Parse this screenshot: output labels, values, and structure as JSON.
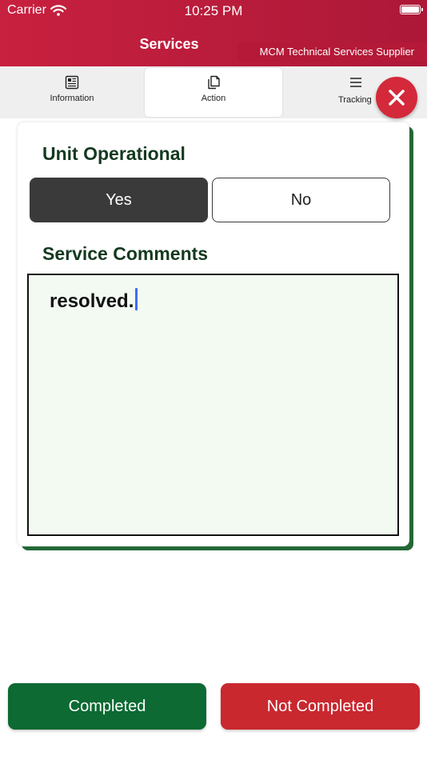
{
  "status_bar": {
    "carrier": "Carrier",
    "time": "10:25 PM"
  },
  "header": {
    "title": "Services",
    "supplier": "MCM Technical Services Supplier"
  },
  "tabs": [
    {
      "label": "Information",
      "icon": "document-icon"
    },
    {
      "label": "Action",
      "icon": "copy-icon"
    },
    {
      "label": "Tracking",
      "icon": "list-icon"
    }
  ],
  "close_icon": "close-icon",
  "form": {
    "unit_operational_label": "Unit Operational",
    "yes_label": "Yes",
    "no_label": "No",
    "selected": "Yes",
    "service_comments_label": "Service Comments",
    "service_comments_value": "resolved."
  },
  "actions": {
    "completed_label": "Completed",
    "not_completed_label": "Not Completed"
  },
  "colors": {
    "header": "#c8203f",
    "accent_green": "#0c6a32",
    "accent_red": "#c9282f",
    "label_green": "#14391f",
    "comment_bg": "#f2faf1"
  }
}
